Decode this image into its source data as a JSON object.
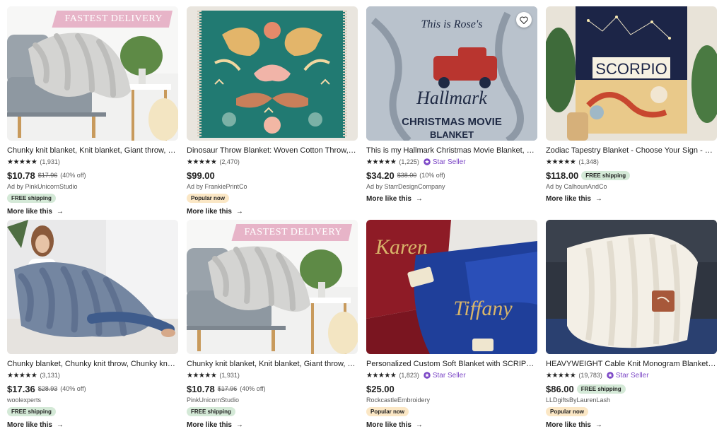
{
  "colors": {
    "star_seller": "#7b46c6",
    "ship_pill": "#d4e9d7",
    "popular_pill": "#fbe7c5",
    "promo": "#e7b4c8"
  },
  "listings": [
    {
      "title": "Chunky knit blanket, Knit blanket, Giant throw, …",
      "stars": "★★★★★",
      "count": "(1,931)",
      "star_seller": "",
      "price": "$10.78",
      "orig": "$17.96",
      "disc": "(40% off)",
      "ship_inline": "",
      "seller": "Ad by PinkUnicornStudio",
      "pill": "FREE shipping",
      "pill_kind": "green",
      "promo": "FASTEST DELIVERY",
      "more": "More like this"
    },
    {
      "title": "Dinosaur Throw Blanket: Woven Cotton Throw, …",
      "stars": "★★★★★",
      "count": "(2,470)",
      "star_seller": "",
      "price": "$99.00",
      "orig": "",
      "disc": "",
      "ship_inline": "",
      "seller": "Ad by FrankiePrintCo",
      "pill": "Popular now",
      "pill_kind": "peach",
      "promo": "",
      "more": "More like this"
    },
    {
      "title": "This is my Hallmark Christmas Movie Blanket, B…",
      "stars": "★★★★★",
      "count": "(1,225)",
      "star_seller": "Star Seller",
      "price": "$34.20",
      "orig": "$38.00",
      "disc": "(10% off)",
      "ship_inline": "",
      "seller": "Ad by StarrDesignCompany",
      "pill": "",
      "pill_kind": "",
      "promo": "",
      "more": "More like this"
    },
    {
      "title": "Zodiac Tapestry Blanket - Choose Your Sign - H…",
      "stars": "★★★★★",
      "count": "(1,348)",
      "star_seller": "",
      "price": "$118.00",
      "orig": "",
      "disc": "",
      "ship_inline": "FREE shipping",
      "seller": "Ad by CalhounAndCo",
      "pill": "",
      "pill_kind": "",
      "promo": "",
      "more": "More like this"
    },
    {
      "title": "Chunky blanket, Chunky knit throw, Chunky kn…",
      "stars": "★★★★★",
      "count": "(3,131)",
      "star_seller": "",
      "price": "$17.36",
      "orig": "$28.93",
      "disc": "(40% off)",
      "ship_inline": "",
      "seller": "woolexperts",
      "pill": "FREE shipping",
      "pill_kind": "green",
      "promo": "",
      "more": "More like this"
    },
    {
      "title": "Chunky knit blanket, Knit blanket, Giant throw, …",
      "stars": "★★★★★",
      "count": "(1,931)",
      "star_seller": "",
      "price": "$10.78",
      "orig": "$17.96",
      "disc": "(40% off)",
      "ship_inline": "",
      "seller": "PinkUnicornStudio",
      "pill": "FREE shipping",
      "pill_kind": "green",
      "promo": "FASTEST DELIVERY",
      "more": "More like this"
    },
    {
      "title": "Personalized Custom Soft Blanket with SCRIPT …",
      "stars": "★★★★★",
      "count": "(1,823)",
      "star_seller": "Star Seller",
      "price": "$25.00",
      "orig": "",
      "disc": "",
      "ship_inline": "",
      "seller": "RockcastleEmbroidery",
      "pill": "Popular now",
      "pill_kind": "peach",
      "promo": "",
      "more": "More like this"
    },
    {
      "title": "HEAVYWEIGHT Cable Knit Monogram Blanket - …",
      "stars": "★★★★★",
      "count": "(19,783)",
      "star_seller": "Star Seller",
      "price": "$86.00",
      "orig": "",
      "disc": "",
      "ship_inline": "FREE shipping",
      "seller": "LLDgiftsByLaurenLash",
      "pill": "Popular now",
      "pill_kind": "peach",
      "promo": "",
      "more": "More like this"
    }
  ],
  "image_text": {
    "hallmark_1": "This is Rose's",
    "hallmark_2": "Hallmark",
    "hallmark_3": "CHRISTMAS MOVIE",
    "hallmark_4": "BLANKET",
    "zodiac": "SCORPIO",
    "name_1": "Karen",
    "name_2": "Tiffany"
  }
}
